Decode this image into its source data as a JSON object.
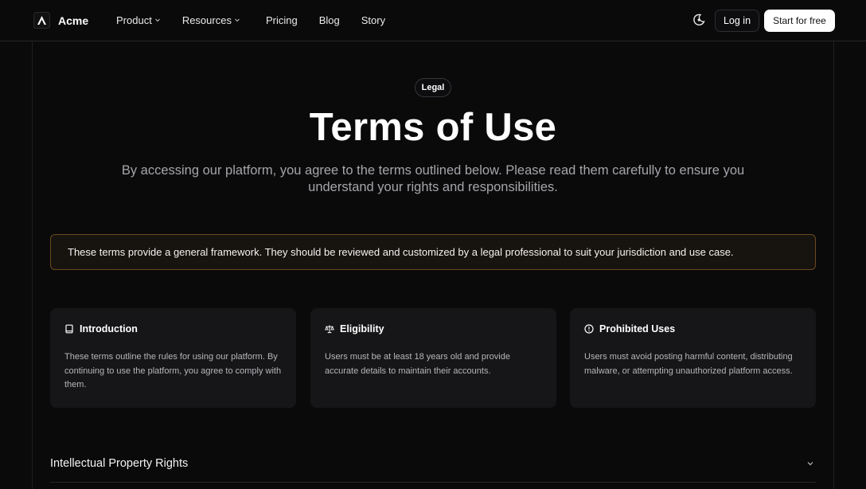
{
  "nav": {
    "brand": "Acme",
    "links": [
      {
        "label": "Product",
        "has_menu": true
      },
      {
        "label": "Resources",
        "has_menu": true
      },
      {
        "label": "Pricing",
        "has_menu": false
      },
      {
        "label": "Blog",
        "has_menu": false
      },
      {
        "label": "Story",
        "has_menu": false
      }
    ],
    "login_label": "Log in",
    "cta_label": "Start for free",
    "theme_icon": "moon-sun-icon"
  },
  "hero": {
    "badge": "Legal",
    "title": "Terms of Use",
    "subtitle": "By accessing our platform, you agree to the terms outlined below. Please read them carefully to ensure you understand your rights and responsibilities."
  },
  "notice": {
    "text": "These terms provide a general framework. They should be reviewed and customized by a legal professional to suit your jurisdiction and use case."
  },
  "cards": [
    {
      "icon": "book-icon",
      "title": "Introduction",
      "text": "These terms outline the rules for using our platform. By continuing to use the platform, you agree to comply with them."
    },
    {
      "icon": "scale-icon",
      "title": "Eligibility",
      "text": "Users must be at least 18 years old and provide accurate details to maintain their accounts."
    },
    {
      "icon": "alert-circle-icon",
      "title": "Prohibited Uses",
      "text": "Users must avoid posting harmful content, distributing malware, or attempting unauthorized platform access."
    }
  ],
  "accordion": [
    {
      "title": "Intellectual Property Rights",
      "expanded": false
    }
  ],
  "colors": {
    "background": "#0a0a0b",
    "notice_border": "#6b4a1f",
    "card_bg": "#161618"
  }
}
